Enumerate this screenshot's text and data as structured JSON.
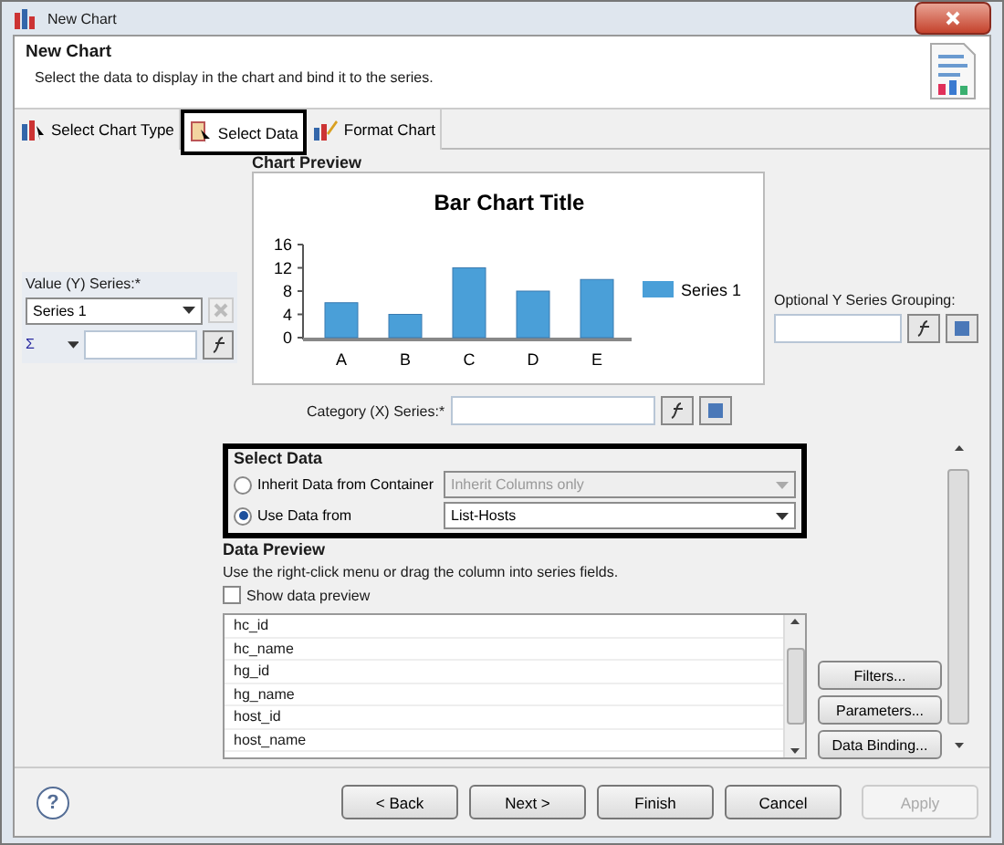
{
  "window": {
    "title": "New Chart"
  },
  "header": {
    "title": "New Chart",
    "description": "Select the data to display in the chart and bind it to the series."
  },
  "tabs": [
    {
      "label": "Select Chart Type",
      "selected": false
    },
    {
      "label": "Select Data",
      "selected": true
    },
    {
      "label": "Format Chart",
      "selected": false
    }
  ],
  "chart_preview": {
    "label": "Chart Preview",
    "chart_data": {
      "type": "bar",
      "title": "Bar Chart Title",
      "categories": [
        "A",
        "B",
        "C",
        "D",
        "E"
      ],
      "series": [
        {
          "name": "Series 1",
          "color": "#4a9fd8",
          "values": [
            6,
            4,
            12,
            8,
            10
          ]
        }
      ],
      "ylim": [
        0,
        16
      ],
      "yticks": [
        0,
        4,
        8,
        12,
        16
      ]
    }
  },
  "value_series": {
    "label": "Value (Y) Series:*",
    "selected": "Series 1",
    "aggregate_symbol": "Σ"
  },
  "grouping": {
    "label": "Optional Y Series Grouping:"
  },
  "category": {
    "label": "Category (X) Series:*"
  },
  "select_data": {
    "title": "Select Data",
    "options": [
      {
        "label": "Inherit Data from Container",
        "selected": false,
        "value": "Inherit Columns only"
      },
      {
        "label": "Use Data from",
        "selected": true,
        "value": "List-Hosts"
      }
    ]
  },
  "data_preview": {
    "title": "Data Preview",
    "hint": "Use the right-click menu or drag the column into series fields.",
    "show_preview": {
      "label": "Show data preview",
      "checked": false
    },
    "columns": [
      "hc_id",
      "hc_name",
      "hg_id",
      "hg_name",
      "host_id",
      "host_name"
    ],
    "buttons": [
      "Filters...",
      "Parameters...",
      "Data Binding..."
    ]
  },
  "footer": {
    "help": "?",
    "buttons": [
      {
        "label": "< Back",
        "disabled": false
      },
      {
        "label": "Next >",
        "disabled": false
      },
      {
        "label": "Finish",
        "disabled": false
      },
      {
        "label": "Cancel",
        "disabled": false
      },
      {
        "label": "Apply",
        "disabled": true
      }
    ]
  }
}
